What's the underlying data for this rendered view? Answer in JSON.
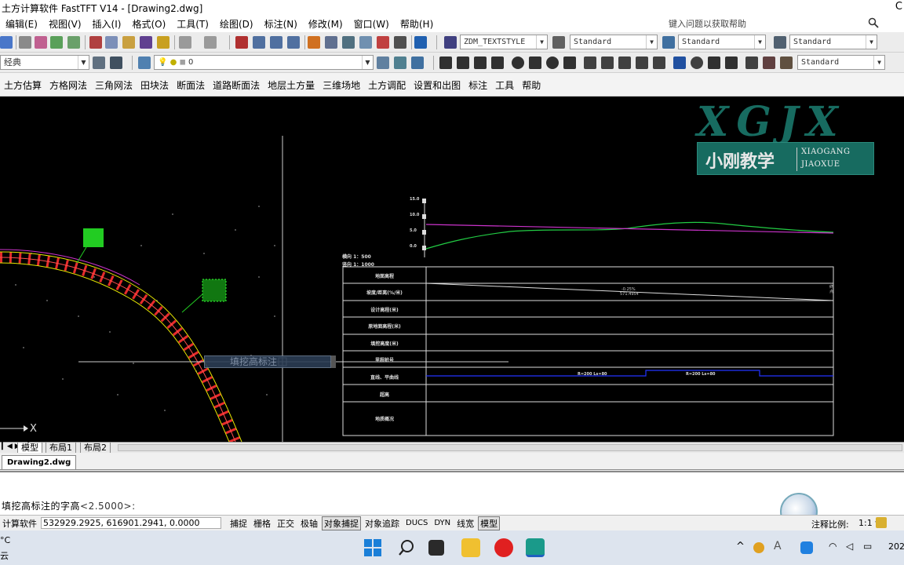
{
  "window": {
    "title": "土方计算软件 FastTFT V14 - [Drawing2.dwg]",
    "close_glyph": "C"
  },
  "menu": [
    "编辑(E)",
    "视图(V)",
    "插入(I)",
    "格式(O)",
    "工具(T)",
    "绘图(D)",
    "标注(N)",
    "修改(M)",
    "窗口(W)",
    "帮助(H)"
  ],
  "help_search": {
    "placeholder": "键入问题以获取帮助"
  },
  "toolbar": {
    "text_style": "ZDM_TEXTSTYLE",
    "dim_style": "Standard",
    "table_style": "Standard",
    "multileader_style": "Standard",
    "workspace": "经典",
    "layer": "0",
    "right_style": "Standard"
  },
  "custom_menu": [
    "土方估算",
    "方格网法",
    "三角网法",
    "田块法",
    "断面法",
    "道路断面法",
    "地层土方量",
    "三维场地",
    "土方调配",
    "设置和出图",
    "标注",
    "工具",
    "帮助"
  ],
  "canvas": {
    "ucs_label": "X",
    "tooltip": "填挖高标注",
    "scale_labels": [
      "横向 1：500",
      "竖向 1：1000"
    ],
    "profile_row_labels": [
      "地面高程",
      "坡度/距离(%/米)",
      "设计高程(米)",
      "原地面高程(米)",
      "填挖高度(米)",
      "里程桩号",
      "直线、平曲线",
      "超高",
      "地质概况"
    ],
    "elev_ticks": [
      "15.0",
      "10.0",
      "5.0",
      "0.0"
    ],
    "slope_label_1": "-0.25%",
    "slope_label_2": "571.4954",
    "curve_label_1": "R=200 Ls=80",
    "curve_label_2": "R=200 Ls=80",
    "end_label": "终点"
  },
  "logo": {
    "mark": "XGJX",
    "cn": "小刚教学",
    "en1": "XIAOGANG",
    "en2": "JIAOXUE"
  },
  "layout_tabs": [
    "模型",
    "布局1",
    "布局2"
  ],
  "doc_tab": "Drawing2.dwg",
  "command": {
    "prompt": "填挖高标注的字高",
    "default": "<2.5000>:"
  },
  "status": {
    "app_label": "计算软件",
    "coords": "532929.2925,  616901.2941,  0.0000",
    "toggles": [
      "捕捉",
      "栅格",
      "正交",
      "极轴",
      "对象捕捉",
      "对象追踪",
      "DUCS",
      "DYN",
      "线宽",
      "模型"
    ],
    "scale_label": "注释比例:",
    "scale_value": "1:1"
  },
  "taskbar": {
    "weather_1": "°C",
    "weather_2": "云",
    "clock": "202"
  },
  "colors": {
    "canvas_bg": "#000000",
    "road": "#ff3030",
    "edge": "#e6e600",
    "ground_line": "#00cc44",
    "design_line": "#cc33cc",
    "logo_green": "#176b60"
  }
}
